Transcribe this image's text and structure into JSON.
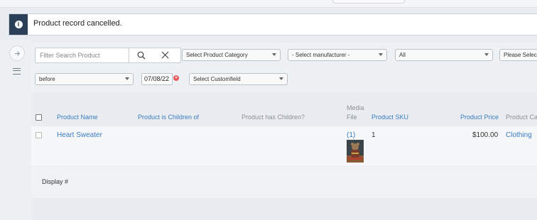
{
  "alert": {
    "message": "Product record cancelled.",
    "icon": "info-icon"
  },
  "sidebar": {
    "expand_icon": "arrow-right-icon",
    "menu_icon": "hamburger-menu-icon"
  },
  "filters": {
    "search_placeholder": "Filter Search Product",
    "category": "Select Product Category",
    "manufacturer": "- Select manufacturer -",
    "status": "All",
    "other": "Please Select",
    "date_mode": "before",
    "date_value": "07/08/22",
    "customfield": "Select Customfield"
  },
  "table": {
    "headers": {
      "name": "Product Name",
      "children_of": "Product is Children of",
      "has_children": "Product has Children?",
      "media_line1": "Media",
      "media_line2": "File",
      "sku": "Product SKU",
      "price": "Product Price",
      "category": "Product Ca"
    },
    "rows": [
      {
        "name": "Heart Sweater",
        "media_count": "(1)",
        "sku": "1",
        "price": "$100.00",
        "category": "Clothing"
      }
    ]
  },
  "footer": {
    "display_label": "Display #"
  },
  "colors": {
    "accent": "#3a7bbf",
    "alert_icon_bg": "#2b3f57",
    "clear_button": "#e35b5b"
  }
}
